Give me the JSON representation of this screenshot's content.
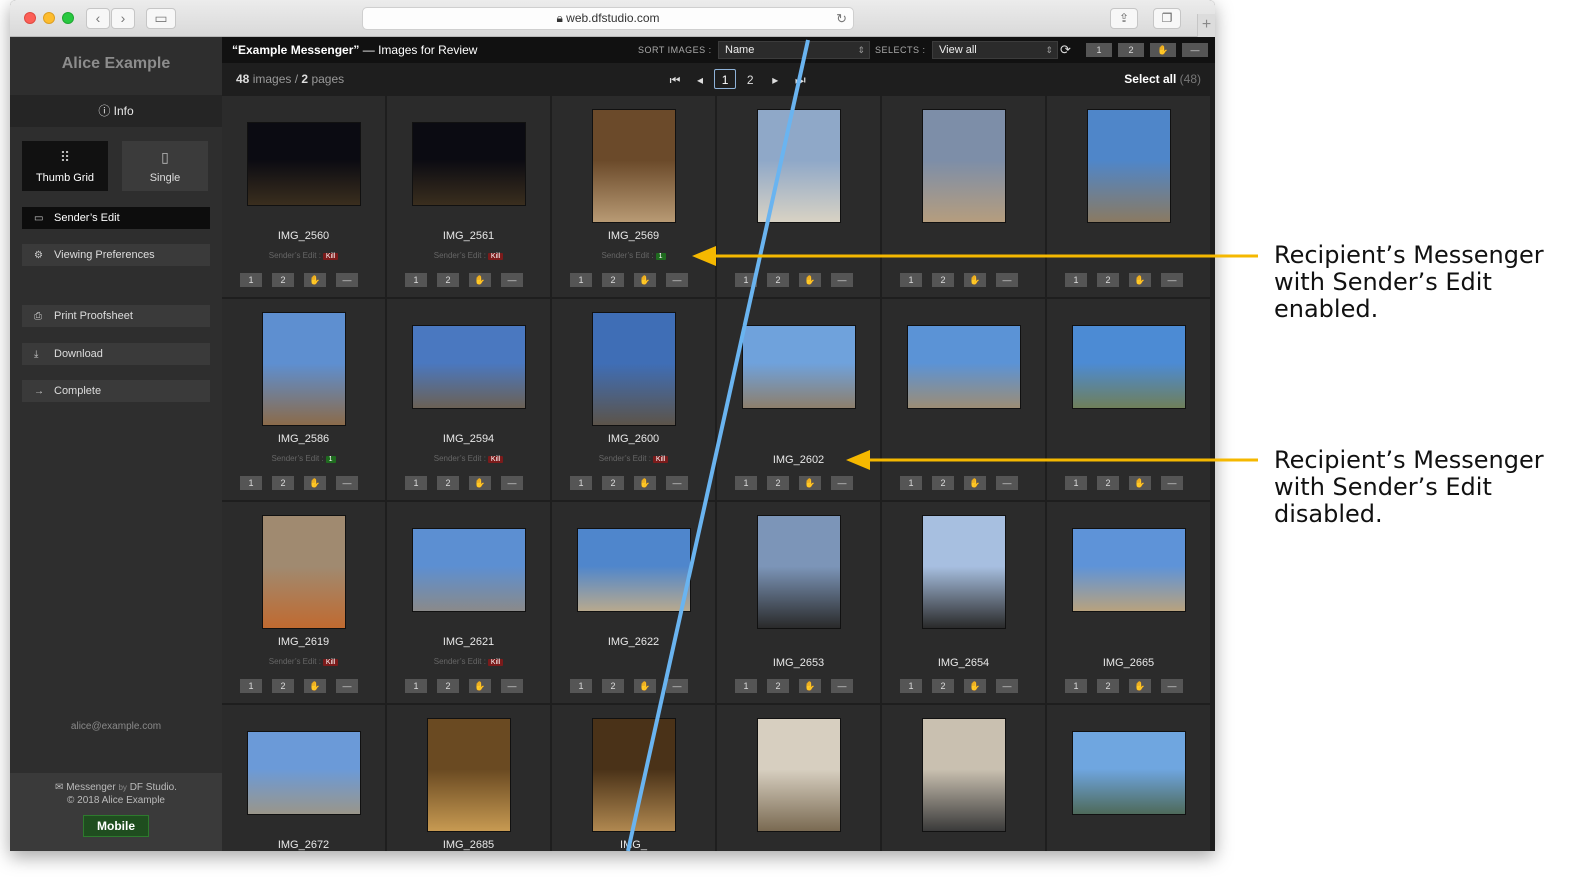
{
  "browser": {
    "url": "web.dfstudio.com",
    "back_icon": "chevron-left",
    "forward_icon": "chevron-right"
  },
  "sidebar": {
    "user_name": "Alice Example",
    "info_label": "Info",
    "view_modes": [
      {
        "label": "Thumb Grid",
        "active": true
      },
      {
        "label": "Single",
        "active": false
      }
    ],
    "senders_edit": "Sender’s Edit",
    "viewing_preferences": "Viewing Preferences",
    "print_proofsheet": "Print Proofsheet",
    "download": "Download",
    "complete": "Complete",
    "email": "alice@example.com",
    "footer_messenger": "Messenger",
    "footer_by": "by",
    "footer_brand": "DF Studio.",
    "footer_copyright": "© 2018 Alice Example",
    "mobile_button": "Mobile"
  },
  "toolbar": {
    "title_quoted": "“Example Messenger”",
    "title_rest": "— Images for Review",
    "sort_label": "SORT IMAGES :",
    "sort_value": "Name",
    "selects_label": "SELECTS :",
    "selects_value": "View all",
    "btn_1": "1",
    "btn_2": "2",
    "btn_minus": "—"
  },
  "subbar": {
    "image_count": "48",
    "images_word": "images /",
    "page_count": "2",
    "pages_word": "pages",
    "current_page": "1",
    "next_page": "2",
    "select_all": "Select all",
    "select_all_count": "(48)"
  },
  "edit_label": "Sender’s Edit :",
  "images": [
    {
      "name": "IMG_2560",
      "edit": "Kill"
    },
    {
      "name": "IMG_2561",
      "edit": "Kill"
    },
    {
      "name": "IMG_2569",
      "edit": "1"
    },
    {
      "name": "",
      "edit": ""
    },
    {
      "name": "",
      "edit": ""
    },
    {
      "name": "",
      "edit": ""
    },
    {
      "name": "IMG_2586",
      "edit": "1"
    },
    {
      "name": "IMG_2594",
      "edit": "Kill"
    },
    {
      "name": "IMG_2600",
      "edit": "Kill"
    },
    {
      "name": "IMG_2602",
      "edit": ""
    },
    {
      "name": "",
      "edit": ""
    },
    {
      "name": "",
      "edit": ""
    },
    {
      "name": "IMG_2619",
      "edit": "Kill"
    },
    {
      "name": "IMG_2621",
      "edit": "Kill"
    },
    {
      "name": "IMG_2622",
      "edit": ""
    },
    {
      "name": "IMG_2653",
      "edit": ""
    },
    {
      "name": "IMG_2654",
      "edit": ""
    },
    {
      "name": "IMG_2665",
      "edit": ""
    },
    {
      "name": "IMG_2672",
      "edit": ""
    },
    {
      "name": "IMG_2685",
      "edit": ""
    },
    {
      "name": "IMG_",
      "edit": ""
    },
    {
      "name": "",
      "edit": ""
    },
    {
      "name": "",
      "edit": ""
    },
    {
      "name": "",
      "edit": ""
    }
  ],
  "callouts": [
    {
      "text": "Recipient’s Messenger with Sender’s Edit enabled."
    },
    {
      "text": "Recipient’s Messenger with Sender’s Edit disabled."
    }
  ],
  "colors": {
    "accent_line": "#6ab4f0",
    "arrow": "#f5b800",
    "kill_tag": "#7b1b1b",
    "select_tag": "#1f6b1f"
  }
}
